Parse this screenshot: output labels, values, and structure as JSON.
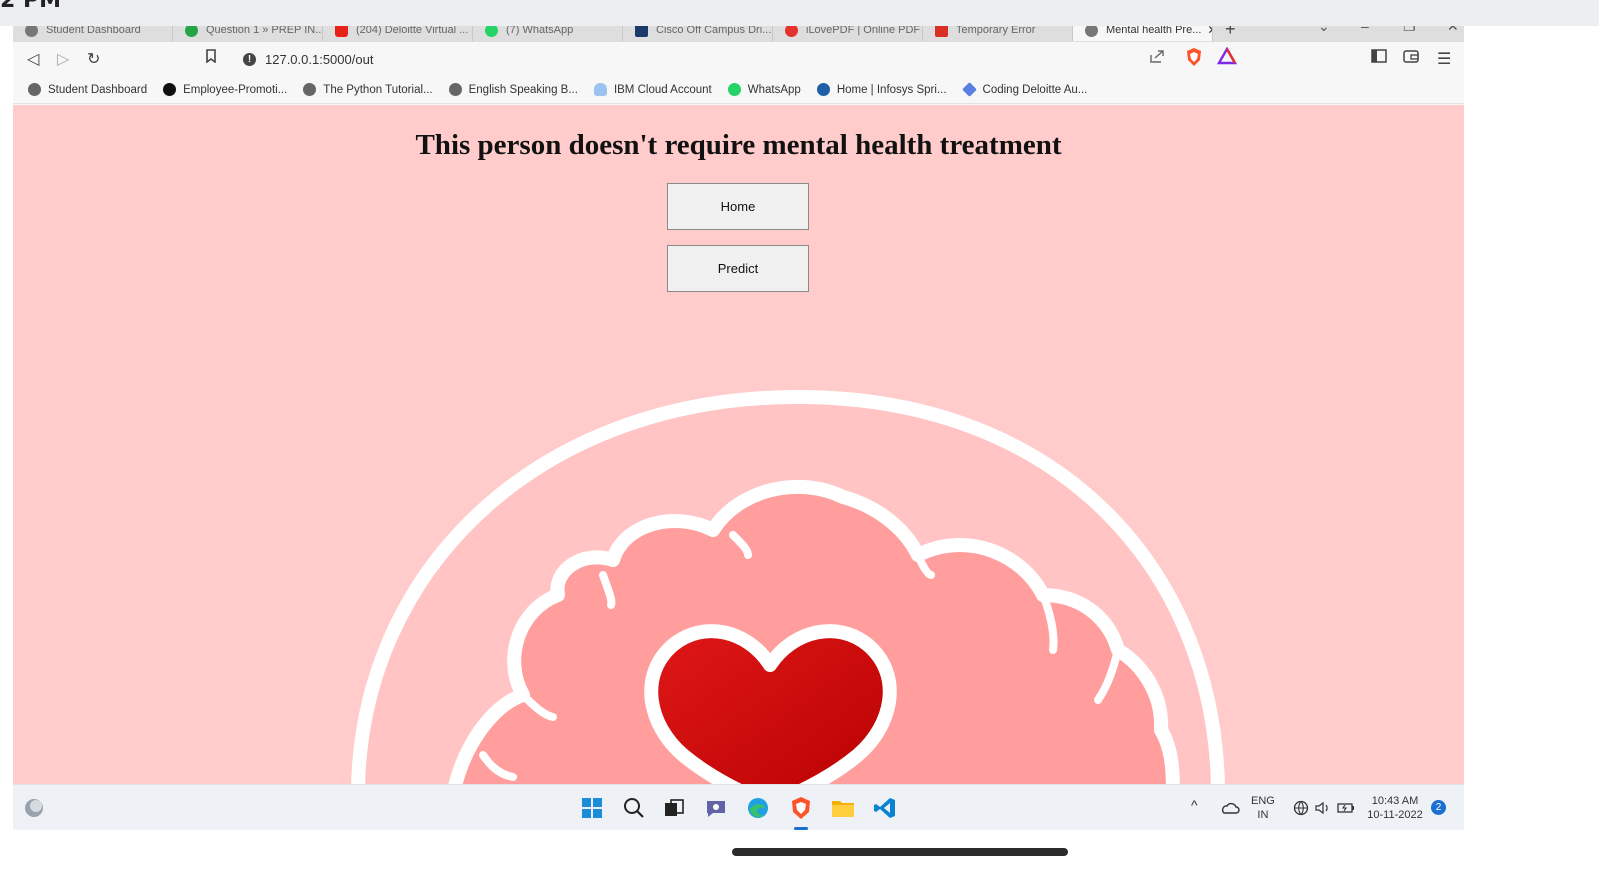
{
  "phone": {
    "time_partial": "2 PM"
  },
  "browser": {
    "tabs": [
      {
        "label": "Student Dashboard",
        "icon": "globe-icon",
        "color": "#666666"
      },
      {
        "label": "Question 1 » PREP IN...",
        "icon": "check-icon",
        "color": "#22a447"
      },
      {
        "label": "(204) Deloitte Virtual ...",
        "icon": "youtube-icon",
        "color": "#e62117"
      },
      {
        "label": "(7) WhatsApp",
        "icon": "whatsapp-icon",
        "color": "#25d366"
      },
      {
        "label": "Cisco Off Campus Dri...",
        "icon": "cisco-icon",
        "color": "#1b3a6b"
      },
      {
        "label": "iLovePDF | Online PDF",
        "icon": "heart-icon",
        "color": "#e5322d"
      },
      {
        "label": "Temporary Error",
        "icon": "gmail-icon",
        "color": "#d93025"
      },
      {
        "label": "Mental health Pre...",
        "icon": "globe-icon",
        "color": "#666666",
        "active": true
      }
    ],
    "url": "127.0.0.1:5000/out",
    "bookmarks": [
      {
        "label": "Student Dashboard",
        "icon": "globe-icon",
        "color": "#555555"
      },
      {
        "label": "Employee-Promoti...",
        "icon": "github-icon",
        "color": "#111111"
      },
      {
        "label": "The Python Tutorial...",
        "icon": "globe-icon",
        "color": "#555555"
      },
      {
        "label": "English Speaking B...",
        "icon": "globe-icon",
        "color": "#555555"
      },
      {
        "label": "IBM Cloud Account",
        "icon": "cloud-icon",
        "color": "#4a90d9"
      },
      {
        "label": "WhatsApp",
        "icon": "whatsapp-icon",
        "color": "#25d366"
      },
      {
        "label": "Home | Infosys Spri...",
        "icon": "infosys-icon",
        "color": "#1f5fa8"
      },
      {
        "label": "Coding Deloitte Au...",
        "icon": "diamond-icon",
        "color": "#5b7fe0"
      }
    ]
  },
  "page": {
    "heading": "This person doesn't require mental health treatment",
    "buttons": {
      "home": "Home",
      "predict": "Predict"
    },
    "background_color": "#ffcccb"
  },
  "taskbar": {
    "lang_line1": "ENG",
    "lang_line2": "IN",
    "time": "10:43 AM",
    "date": "10-11-2022",
    "notification_count": "2"
  }
}
